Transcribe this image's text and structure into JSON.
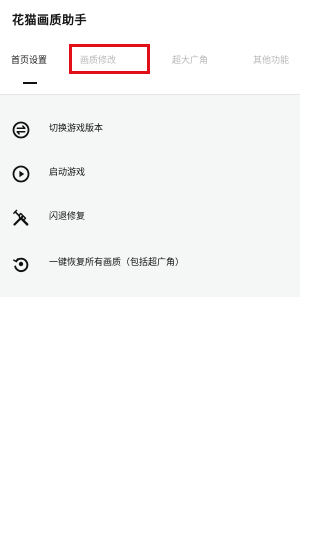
{
  "app": {
    "title": "花猫画质助手"
  },
  "tabs": [
    {
      "label": "首页设置",
      "active": true
    },
    {
      "label": "画质修改",
      "active": false,
      "highlighted": true
    },
    {
      "label": "超大广角",
      "active": false
    },
    {
      "label": "其他功能",
      "active": false
    }
  ],
  "menu": [
    {
      "label": "切换游戏版本",
      "icon": "swap-arrows-icon"
    },
    {
      "label": "启动游戏",
      "icon": "play-circle-icon"
    },
    {
      "label": "闪退修复",
      "icon": "tools-repair-icon"
    },
    {
      "label": "一键恢复所有画质（包括超广角）",
      "icon": "restore-icon"
    }
  ],
  "colors": {
    "highlight": "#e10f17",
    "panel_bg": "#f5f7f7",
    "inactive_tab": "#b8b8b8"
  }
}
